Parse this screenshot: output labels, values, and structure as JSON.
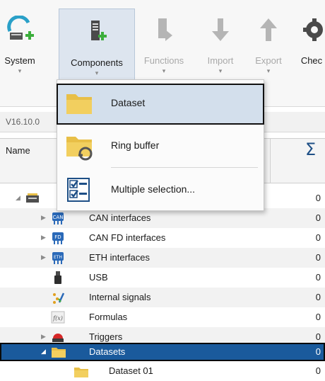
{
  "ribbon": {
    "buttons": [
      {
        "label": "System"
      },
      {
        "label": "Components"
      },
      {
        "label": "Functions"
      },
      {
        "label": "Import"
      },
      {
        "label": "Export"
      },
      {
        "label": "Chec"
      }
    ]
  },
  "version": {
    "text": "V16.10.0"
  },
  "columns": {
    "name": "Name",
    "sum_symbol": "Σ"
  },
  "tree": {
    "rows": [
      {
        "label": "",
        "value": "0"
      },
      {
        "label": "CAN interfaces",
        "value": "0",
        "icon": "can-icon"
      },
      {
        "label": "CAN FD interfaces",
        "value": "0",
        "icon": "can-fd-icon"
      },
      {
        "label": "ETH interfaces",
        "value": "0",
        "icon": "eth-icon"
      },
      {
        "label": "USB",
        "value": "0",
        "icon": "usb-icon"
      },
      {
        "label": "Internal signals",
        "value": "0",
        "icon": "internal-signals-icon"
      },
      {
        "label": "Formulas",
        "value": "0",
        "icon": "formula-icon"
      },
      {
        "label": "Triggers",
        "value": "0",
        "icon": "trigger-icon"
      },
      {
        "label": "Datasets",
        "value": "0",
        "icon": "folder-icon"
      },
      {
        "label": "Dataset 01",
        "value": "0",
        "icon": "folder-icon"
      }
    ]
  },
  "dropdown": {
    "items": [
      {
        "label": "Dataset"
      },
      {
        "label": "Ring buffer"
      },
      {
        "label": "Multiple selection..."
      }
    ]
  },
  "colors": {
    "accent": "#1a5a9c",
    "folder": "#e8bf47",
    "green": "#3cae3c"
  }
}
